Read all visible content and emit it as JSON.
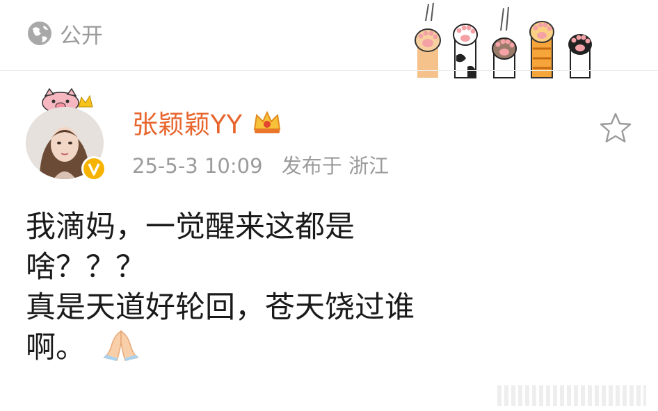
{
  "header": {
    "visibility_label": "公开",
    "visibility_icon": "globe-icon"
  },
  "post": {
    "username": "张颖颖YY",
    "crown_icon": "crown-icon",
    "verified_icon": "verified-badge-icon",
    "date": "25-5-3 10:09",
    "posted_from": "发布于 浙江",
    "favorite_icon": "star-icon",
    "content_lines": [
      "我滴妈，一觉醒来这都是",
      "啥？？？",
      "真是天道好轮回，苍天饶过谁",
      "啊。"
    ],
    "emoji": "pray-emoji"
  },
  "colors": {
    "username": "#e8652d",
    "meta_text": "#9b9b9b",
    "body_text": "#1a1a1a",
    "badge": "#f6b400"
  }
}
